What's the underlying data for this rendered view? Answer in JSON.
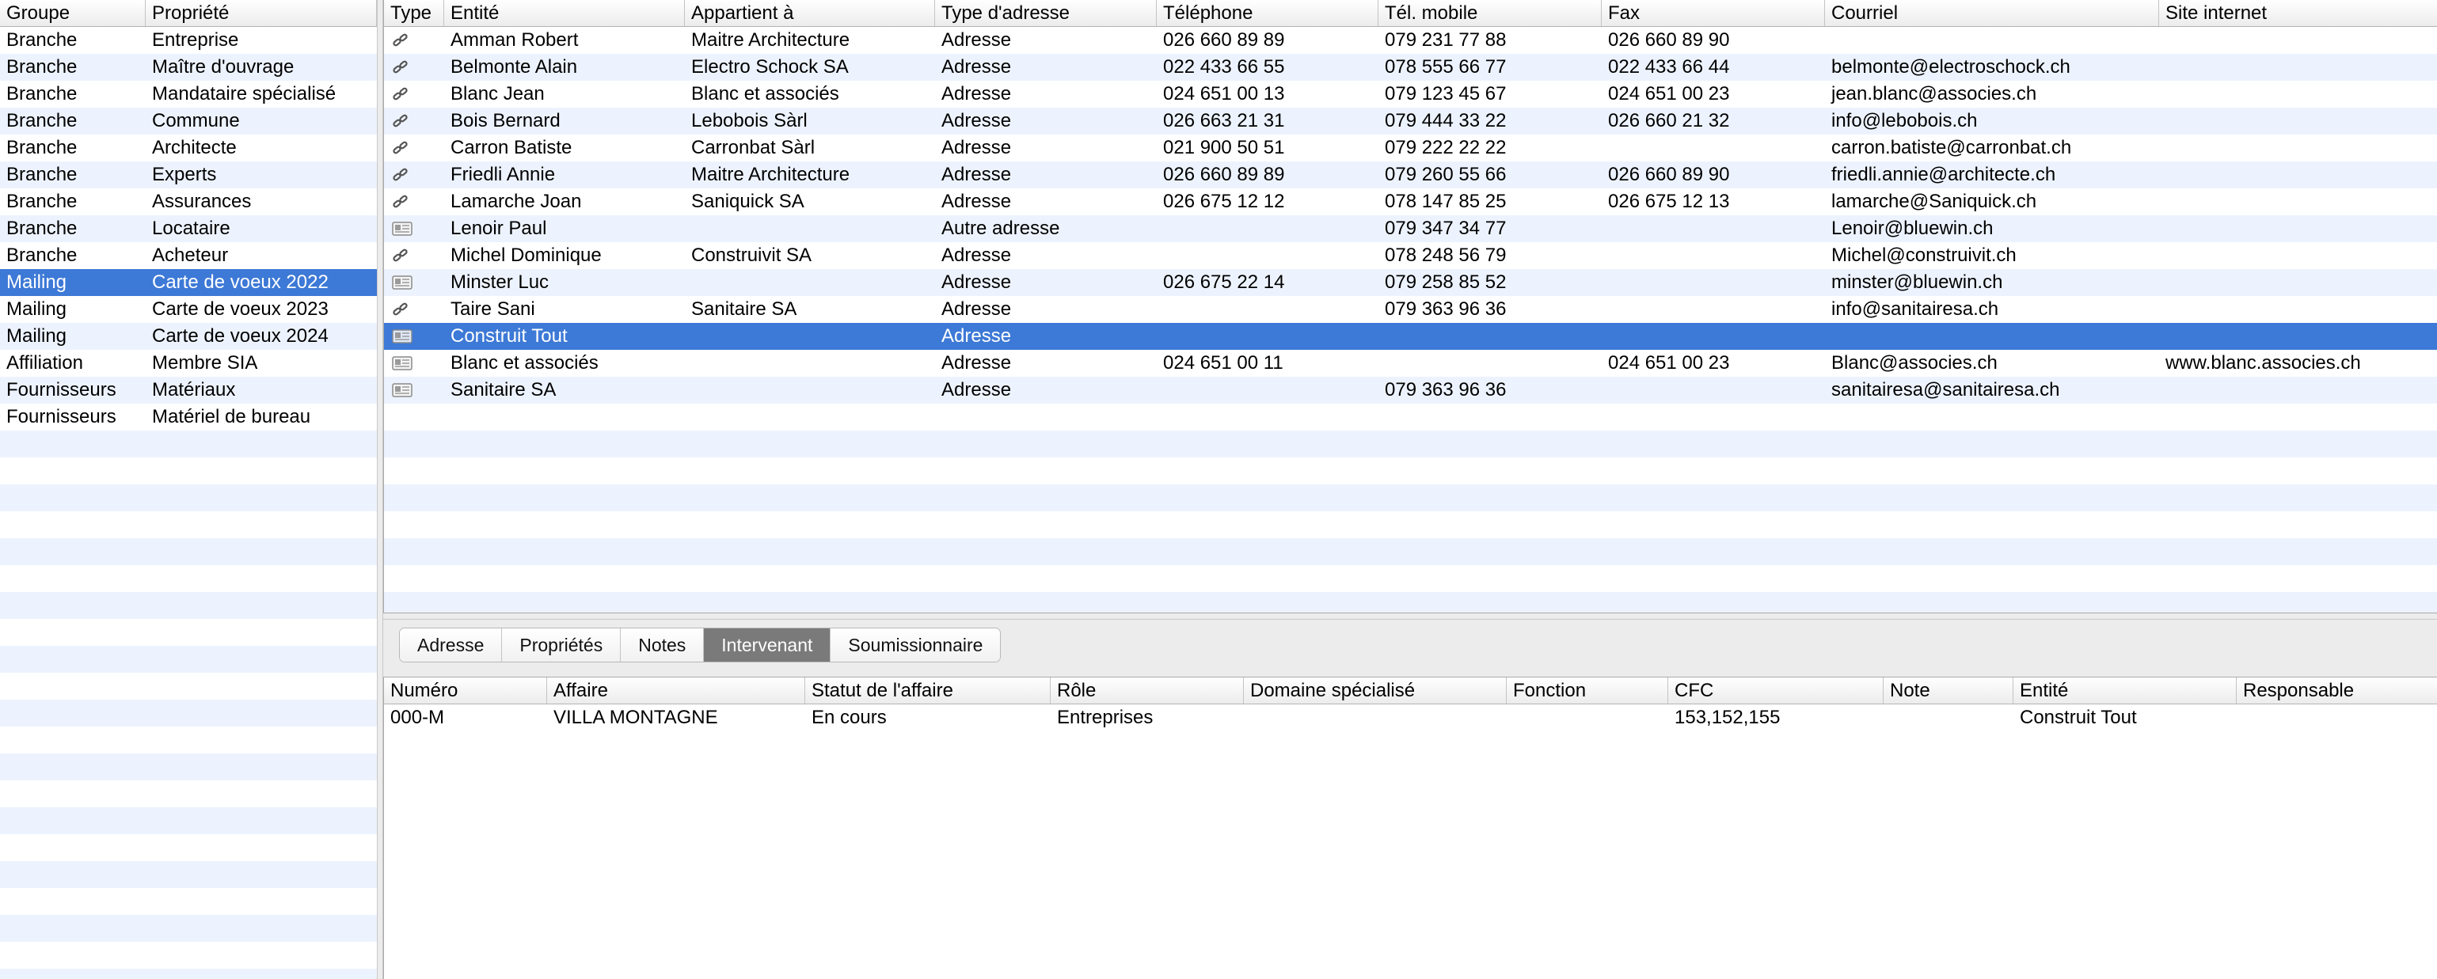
{
  "left_table": {
    "columns": [
      "Groupe",
      "Propriété"
    ],
    "selected_index": 9,
    "rows": [
      {
        "groupe": "Branche",
        "propriete": "Entreprise"
      },
      {
        "groupe": "Branche",
        "propriete": "Maître d'ouvrage"
      },
      {
        "groupe": "Branche",
        "propriete": "Mandataire spécialisé"
      },
      {
        "groupe": "Branche",
        "propriete": "Commune"
      },
      {
        "groupe": "Branche",
        "propriete": "Architecte"
      },
      {
        "groupe": "Branche",
        "propriete": "Experts"
      },
      {
        "groupe": "Branche",
        "propriete": "Assurances"
      },
      {
        "groupe": "Branche",
        "propriete": "Locataire"
      },
      {
        "groupe": "Branche",
        "propriete": "Acheteur"
      },
      {
        "groupe": "Mailing",
        "propriete": "Carte de voeux 2022"
      },
      {
        "groupe": "Mailing",
        "propriete": "Carte de voeux 2023"
      },
      {
        "groupe": "Mailing",
        "propriete": "Carte de voeux 2024"
      },
      {
        "groupe": "Affiliation",
        "propriete": "Membre SIA"
      },
      {
        "groupe": "Fournisseurs",
        "propriete": "Matériaux"
      },
      {
        "groupe": "Fournisseurs",
        "propriete": "Matériel de bureau"
      }
    ]
  },
  "contacts_table": {
    "columns": [
      "Type",
      "Entité",
      "Appartient à",
      "Type d'adresse",
      "Téléphone",
      "Tél. mobile",
      "Fax",
      "Courriel",
      "Site internet"
    ],
    "selected_index": 11,
    "rows": [
      {
        "type_icon": "link-icon",
        "entite": "Amman Robert",
        "appartient": "Maitre Architecture",
        "type_adresse": "Adresse",
        "telephone": "026 660 89 89",
        "mobile": "079 231 77 88",
        "fax": "026 660 89 90",
        "courriel": "",
        "site": ""
      },
      {
        "type_icon": "link-icon",
        "entite": "Belmonte Alain",
        "appartient": "Electro Schock SA",
        "type_adresse": "Adresse",
        "telephone": "022 433 66 55",
        "mobile": "078 555 66 77",
        "fax": "022 433 66 44",
        "courriel": "belmonte@electroschock.ch",
        "site": ""
      },
      {
        "type_icon": "link-icon",
        "entite": "Blanc Jean",
        "appartient": "Blanc et associés",
        "type_adresse": "Adresse",
        "telephone": "024 651 00 13",
        "mobile": "079 123 45 67",
        "fax": "024 651 00 23",
        "courriel": "jean.blanc@associes.ch",
        "site": ""
      },
      {
        "type_icon": "link-icon",
        "entite": "Bois Bernard",
        "appartient": "Lebobois Sàrl",
        "type_adresse": "Adresse",
        "telephone": "026 663 21 31",
        "mobile": "079 444 33 22",
        "fax": "026 660 21 32",
        "courriel": "info@lebobois.ch",
        "site": ""
      },
      {
        "type_icon": "link-icon",
        "entite": "Carron Batiste",
        "appartient": "Carronbat Sàrl",
        "type_adresse": "Adresse",
        "telephone": "021 900 50 51",
        "mobile": "079 222 22 22",
        "fax": "",
        "courriel": "carron.batiste@carronbat.ch",
        "site": ""
      },
      {
        "type_icon": "link-icon",
        "entite": "Friedli Annie",
        "appartient": "Maitre Architecture",
        "type_adresse": "Adresse",
        "telephone": "026 660 89 89",
        "mobile": "079 260 55 66",
        "fax": "026 660 89 90",
        "courriel": "friedli.annie@architecte.ch",
        "site": ""
      },
      {
        "type_icon": "link-icon",
        "entite": "Lamarche Joan",
        "appartient": "Saniquick SA",
        "type_adresse": "Adresse",
        "telephone": "026 675 12 12",
        "mobile": "078 147 85 25",
        "fax": "026 675 12 13",
        "courriel": "lamarche@Saniquick.ch",
        "site": ""
      },
      {
        "type_icon": "card-icon",
        "entite": "Lenoir Paul",
        "appartient": "",
        "type_adresse": "Autre adresse",
        "telephone": "",
        "mobile": "079 347 34 77",
        "fax": "",
        "courriel": "Lenoir@bluewin.ch",
        "site": ""
      },
      {
        "type_icon": "link-icon",
        "entite": "Michel Dominique",
        "appartient": "Construivit SA",
        "type_adresse": "Adresse",
        "telephone": "",
        "mobile": "078 248 56 79",
        "fax": "",
        "courriel": "Michel@construivit.ch",
        "site": ""
      },
      {
        "type_icon": "card-icon",
        "entite": "Minster Luc",
        "appartient": "",
        "type_adresse": "Adresse",
        "telephone": "026 675 22 14",
        "mobile": "079 258 85 52",
        "fax": "",
        "courriel": "minster@bluewin.ch",
        "site": ""
      },
      {
        "type_icon": "link-icon",
        "entite": "Taire Sani",
        "appartient": "Sanitaire SA",
        "type_adresse": "Adresse",
        "telephone": "",
        "mobile": "079 363 96 36",
        "fax": "",
        "courriel": "info@sanitairesa.ch",
        "site": ""
      },
      {
        "type_icon": "card-icon",
        "entite": "Construit Tout",
        "appartient": "",
        "type_adresse": "Adresse",
        "telephone": "",
        "mobile": "",
        "fax": "",
        "courriel": "",
        "site": ""
      },
      {
        "type_icon": "card-icon",
        "entite": "Blanc et associés",
        "appartient": "",
        "type_adresse": "Adresse",
        "telephone": "024 651 00 11",
        "mobile": "",
        "fax": "024 651 00 23",
        "courriel": "Blanc@associes.ch",
        "site": "www.blanc.associes.ch"
      },
      {
        "type_icon": "card-icon",
        "entite": "Sanitaire SA",
        "appartient": "",
        "type_adresse": "Adresse",
        "telephone": "",
        "mobile": "079 363 96 36",
        "fax": "",
        "courriel": "sanitairesa@sanitairesa.ch",
        "site": ""
      }
    ]
  },
  "tabs": {
    "items": [
      "Adresse",
      "Propriétés",
      "Notes",
      "Intervenant",
      "Soumissionnaire"
    ],
    "active_index": 3
  },
  "intervenant_table": {
    "columns": [
      "Numéro",
      "Affaire",
      "Statut de l'affaire",
      "Rôle",
      "Domaine spécialisé",
      "Fonction",
      "CFC",
      "Note",
      "Entité",
      "Responsable"
    ],
    "rows": [
      {
        "numero": "000-M",
        "affaire": "VILLA MONTAGNE",
        "statut": "En cours",
        "role": "Entreprises",
        "domaine": "",
        "fonction": "",
        "cfc": "153,152,155",
        "note": "",
        "entite": "Construit Tout",
        "responsable": ""
      }
    ]
  },
  "colors": {
    "selection": "#3d79d6",
    "alternate_row": "#edf3fe",
    "active_tab": "#7a7a7a"
  }
}
